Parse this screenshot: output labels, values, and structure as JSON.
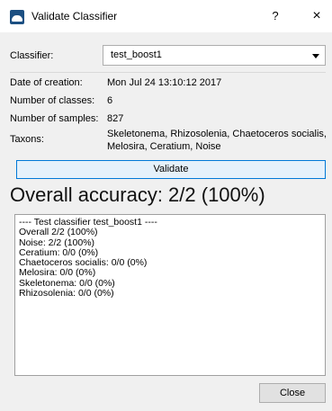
{
  "window": {
    "title": "Validate Classifier",
    "help_label": "?",
    "close_label": "×"
  },
  "classifier": {
    "label": "Classifier:",
    "selected": "test_boost1"
  },
  "info": {
    "date_label": "Date of creation:",
    "date_value": "Mon Jul 24 13:10:12 2017",
    "classes_label": "Number of classes:",
    "classes_value": "6",
    "samples_label": "Number of samples:",
    "samples_value": "827",
    "taxons_label": "Taxons:",
    "taxons_value": "Skeletonema, Rhizosolenia, Chaetoceros socialis, Melosira, Ceratium, Noise"
  },
  "validate_label": "Validate",
  "accuracy_text": "Overall accuracy: 2/2 (100%)",
  "log_lines": [
    "---- Test classifier test_boost1 ----",
    "Overall 2/2 (100%)",
    "Noise: 2/2 (100%)",
    "Ceratium: 0/0 (0%)",
    "Chaetoceros socialis: 0/0 (0%)",
    "Melosira: 0/0 (0%)",
    "Skeletonema: 0/0 (0%)",
    "Rhizosolenia: 0/0 (0%)"
  ],
  "close_button_label": "Close"
}
